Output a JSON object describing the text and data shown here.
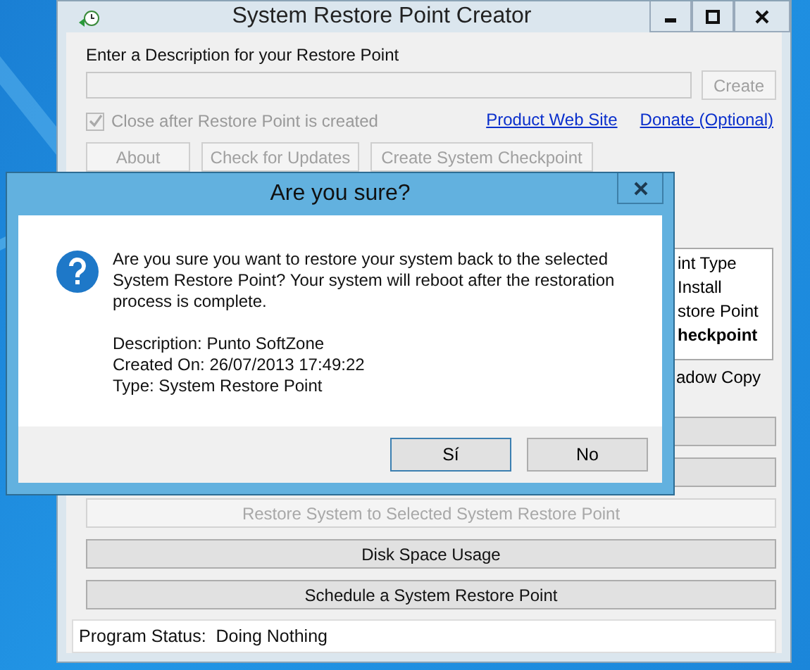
{
  "main_window": {
    "title": "System Restore Point Creator",
    "description_label": "Enter a Description for your Restore Point",
    "create_button": {
      "label": "Create",
      "disabled": true
    },
    "close_after": {
      "label": "Close after Restore Point is created",
      "checked": true,
      "disabled": true
    },
    "links": [
      "Product Web Site",
      "Donate (Optional)"
    ],
    "top_buttons": [
      {
        "label": "About",
        "disabled": true
      },
      {
        "label": "Check for Updates",
        "disabled": true
      },
      {
        "label": "Create System Checkpoint",
        "disabled": true
      }
    ],
    "list_view": {
      "header": "int Type",
      "rows": [
        {
          "text": "Install",
          "bold": false
        },
        {
          "text": "store Point",
          "bold": false
        },
        {
          "text": "heckpoint",
          "bold": true
        }
      ]
    },
    "shadow_copy_label": "adow Copy",
    "action_buttons": [
      {
        "label": "Restore System to Selected System Restore Point",
        "disabled": true
      },
      {
        "label": "Disk Space Usage",
        "disabled": false
      },
      {
        "label": "Schedule a System Restore Point",
        "disabled": false
      }
    ],
    "status_bar": "Program Status:  Doing Nothing"
  },
  "dialog": {
    "title": "Are you sure?",
    "message": "Are you sure you want to restore your system back to the selected System Restore Point?  Your system will reboot after the restoration process is complete.",
    "details": [
      "Description: Punto SoftZone",
      "Created On: 26/07/2013 17:49:22",
      "Type: System Restore Point"
    ],
    "buttons": [
      {
        "label": "Sí",
        "focused": true
      },
      {
        "label": "No",
        "focused": false
      }
    ]
  }
}
